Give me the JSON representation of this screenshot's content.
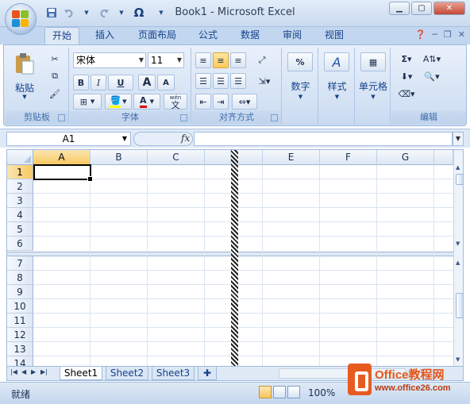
{
  "window": {
    "title": "Book1 - Microsoft Excel",
    "minimize_icon": "minimize-icon",
    "maximize_icon": "restore-icon",
    "close_icon": "close-icon"
  },
  "quick_access": {
    "items": [
      "save-icon",
      "undo-icon",
      "redo-icon",
      "omega-icon",
      "customize-dropdown-icon"
    ],
    "omega": "Ω"
  },
  "tabs": [
    "开始",
    "插入",
    "页面布局",
    "公式",
    "数据",
    "审阅",
    "视图"
  ],
  "active_tab": "开始",
  "ribbon": {
    "clipboard": {
      "label": "剪贴板",
      "paste": "粘贴"
    },
    "font": {
      "label": "字体",
      "font_name": "宋体",
      "font_size": "11",
      "bold": "B",
      "italic": "I",
      "underline": "U",
      "grow": "A",
      "shrink": "A",
      "wen": "wén",
      "phonetic": "文"
    },
    "alignment": {
      "label": "对齐方式"
    },
    "number": {
      "label": "数字",
      "symbol": "%"
    },
    "styles": {
      "label": "样式",
      "symbol": "A"
    },
    "cells": {
      "label": "单元格"
    },
    "editing": {
      "label": "编辑",
      "sum_symbol": "Σ"
    }
  },
  "formula_bar": {
    "name_box": "A1",
    "fx": "fx",
    "content": ""
  },
  "grid": {
    "columns_left": [
      "A",
      "B",
      "C"
    ],
    "columns_right": [
      "E",
      "F",
      "G"
    ],
    "rows_top": [
      "1",
      "2",
      "3",
      "4",
      "5",
      "6"
    ],
    "rows_bottom": [
      "7",
      "8",
      "9",
      "10",
      "11",
      "12",
      "13",
      "14"
    ],
    "selected_column": "A",
    "selected_row": "1"
  },
  "sheets": [
    "Sheet1",
    "Sheet2",
    "Sheet3"
  ],
  "active_sheet": "Sheet1",
  "status": {
    "mode": "就绪",
    "zoom": "100%"
  },
  "watermark": {
    "title": "Office教程网",
    "url": "www.office26.com"
  },
  "colors": {
    "accent": "#15428b",
    "selected_header": "#f8c862",
    "ribbon": "#d4e2f4"
  }
}
